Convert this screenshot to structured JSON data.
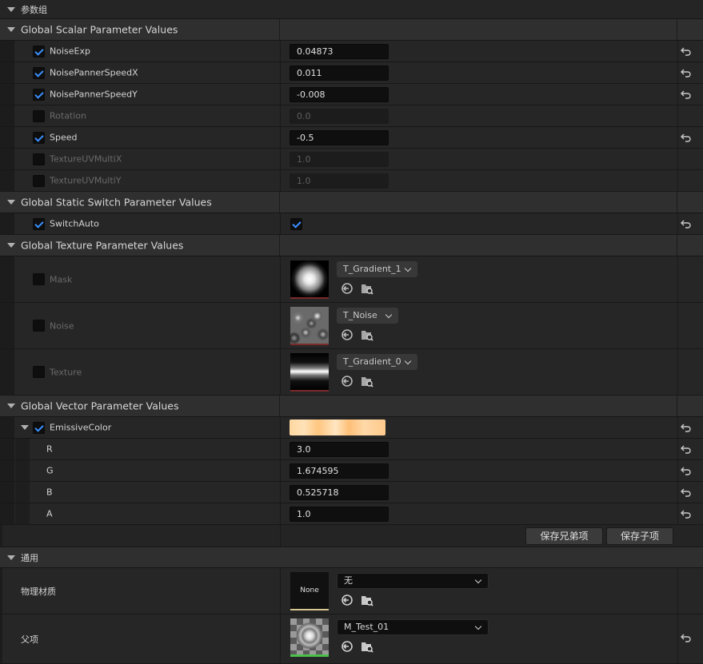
{
  "top_category": {
    "title": "参数组"
  },
  "scalar": {
    "title": "Global Scalar Parameter Values",
    "items": [
      {
        "name": "NoiseExp",
        "value": "0.04873",
        "enabled": true
      },
      {
        "name": "NoisePannerSpeedX",
        "value": "0.011",
        "enabled": true
      },
      {
        "name": "NoisePannerSpeedY",
        "value": "-0.008",
        "enabled": true
      },
      {
        "name": "Rotation",
        "value": "0.0",
        "enabled": false
      },
      {
        "name": "Speed",
        "value": "-0.5",
        "enabled": true
      },
      {
        "name": "TextureUVMultiX",
        "value": "1.0",
        "enabled": false
      },
      {
        "name": "TextureUVMultiY",
        "value": "1.0",
        "enabled": false
      }
    ]
  },
  "static_switch": {
    "title": "Global Static Switch Parameter Values",
    "items": [
      {
        "name": "SwitchAuto",
        "enabled": true,
        "value_checked": true
      }
    ]
  },
  "texture": {
    "title": "Global Texture Parameter Values",
    "items": [
      {
        "name": "Mask",
        "asset": "T_Gradient_1",
        "enabled": false
      },
      {
        "name": "Noise",
        "asset": "T_Noise",
        "enabled": false
      },
      {
        "name": "Texture",
        "asset": "T_Gradient_0",
        "enabled": false
      }
    ]
  },
  "vector": {
    "title": "Global Vector Parameter Values",
    "color_name": "EmissiveColor",
    "enabled": true,
    "components": [
      {
        "name": "R",
        "value": "3.0"
      },
      {
        "name": "G",
        "value": "1.674595"
      },
      {
        "name": "B",
        "value": "0.525718"
      },
      {
        "name": "A",
        "value": "1.0"
      }
    ]
  },
  "buttons": {
    "save_siblings": "保存兄弟项",
    "save_children": "保存子项"
  },
  "general": {
    "title": "通用",
    "phys_material_label": "物理材质",
    "phys_material_value": "无",
    "phys_material_thumb": "None",
    "parent_label": "父项",
    "parent_value": "M_Test_01"
  },
  "icons": {
    "reset": "reset-arrow-icon",
    "browse": "use-selected-asset-icon",
    "find": "browse-folder-icon",
    "expand": "expand-arrow-icon",
    "checkmark": "checkmark-icon"
  },
  "colors": {
    "accent": "#3a90ff",
    "background": "#242424",
    "header": "#2f2f2f"
  }
}
